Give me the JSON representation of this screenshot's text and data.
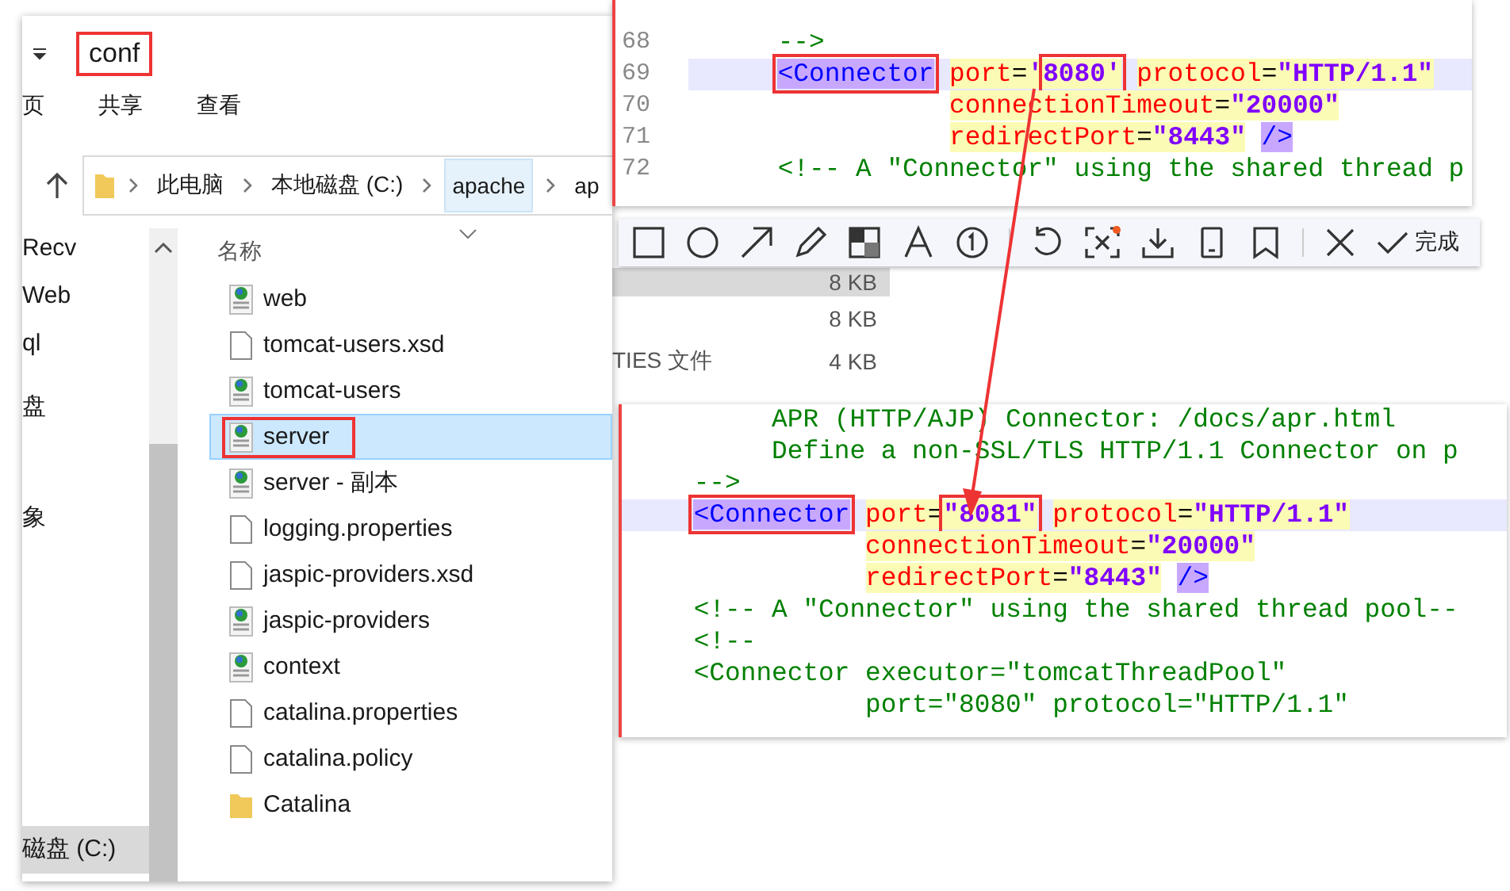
{
  "background_window": {
    "detail_rows": [
      {
        "size": "8 KB",
        "selected": true
      },
      {
        "size": "8 KB",
        "selected": false
      },
      {
        "type": "TIES 文件",
        "size": "4 KB",
        "selected": false
      }
    ]
  },
  "explorer": {
    "title": {
      "text": "conf",
      "annotated": true
    },
    "ribbon_tabs": [
      "页",
      "共享",
      "查看"
    ],
    "address": [
      {
        "label": "此电脑",
        "selected": false
      },
      {
        "label": "本地磁盘 (C:)",
        "selected": false
      },
      {
        "label": "apache",
        "selected": true
      },
      {
        "label": "ap",
        "selected": false
      }
    ],
    "sidebar": [
      {
        "label": "Recv",
        "selected": false
      },
      {
        "label": "Web",
        "selected": false
      },
      {
        "label": "ql",
        "selected": false
      },
      {
        "label": "盘",
        "selected": false
      },
      {
        "label": "象",
        "selected": false
      },
      {
        "label": "磁盘 (C:)",
        "selected": true
      }
    ],
    "column_header": "名称",
    "files": [
      {
        "name": "web",
        "kind": "xml",
        "selected": false,
        "annotated": false
      },
      {
        "name": "tomcat-users.xsd",
        "kind": "file",
        "selected": false,
        "annotated": false
      },
      {
        "name": "tomcat-users",
        "kind": "xml",
        "selected": false,
        "annotated": false
      },
      {
        "name": "server",
        "kind": "xml",
        "selected": true,
        "annotated": true
      },
      {
        "name": "server - 副本",
        "kind": "xml",
        "selected": false,
        "annotated": false
      },
      {
        "name": "logging.properties",
        "kind": "file",
        "selected": false,
        "annotated": false
      },
      {
        "name": "jaspic-providers.xsd",
        "kind": "file",
        "selected": false,
        "annotated": false
      },
      {
        "name": "jaspic-providers",
        "kind": "xml",
        "selected": false,
        "annotated": false
      },
      {
        "name": "context",
        "kind": "xml",
        "selected": false,
        "annotated": false
      },
      {
        "name": "catalina.properties",
        "kind": "file",
        "selected": false,
        "annotated": false
      },
      {
        "name": "catalina.policy",
        "kind": "file",
        "selected": false,
        "annotated": false
      },
      {
        "name": "Catalina",
        "kind": "folder",
        "selected": false,
        "annotated": false
      }
    ]
  },
  "code_before": {
    "lines": [
      {
        "number": "68",
        "kind": "element",
        "current": false,
        "tokens": [
          {
            "text": "-->",
            "kind": "comment",
            "boxed": false
          }
        ]
      },
      {
        "number": "69",
        "kind": "element",
        "current": true,
        "tokens": [
          {
            "text": "<Connector",
            "kind": "tag",
            "boxed": true
          },
          {
            "text": "port",
            "kind": "attr",
            "boxed": false
          },
          {
            "text": "=",
            "kind": "eq",
            "boxed": false
          },
          {
            "text": "'",
            "kind": "str",
            "boxed": false
          },
          {
            "text": "8080'",
            "kind": "str",
            "boxed": true
          },
          {
            "text": "protocol",
            "kind": "attr",
            "boxed": false
          },
          {
            "text": "=",
            "kind": "eq",
            "boxed": false
          },
          {
            "text": "\"HTTP/1.1\"",
            "kind": "str",
            "boxed": false
          }
        ]
      },
      {
        "number": "70",
        "kind": "continuation",
        "current": false,
        "tokens": [
          {
            "text": "connectionTimeout",
            "kind": "attr",
            "boxed": false
          },
          {
            "text": "=",
            "kind": "eq",
            "boxed": false
          },
          {
            "text": "\"20000\"",
            "kind": "str",
            "boxed": false
          }
        ]
      },
      {
        "number": "71",
        "kind": "continuation",
        "current": false,
        "tokens": [
          {
            "text": "redirectPort",
            "kind": "attr",
            "boxed": false
          },
          {
            "text": "=",
            "kind": "eq",
            "boxed": false
          },
          {
            "text": "\"8443\"",
            "kind": "str",
            "boxed": false
          },
          {
            "text": "/>",
            "kind": "tag",
            "boxed": false
          }
        ]
      },
      {
        "number": "72",
        "kind": "element",
        "current": false,
        "tokens": [
          {
            "text": "<!-- A \"Connector\" using the shared thread p",
            "kind": "comment",
            "boxed": false
          }
        ]
      }
    ]
  },
  "capture_toolbar": {
    "done_label": "完成"
  },
  "code_after": {
    "lines": [
      {
        "kind": "comment-body",
        "current": false,
        "tokens": [
          {
            "text": "APR (HTTP/AJP) Connector: /docs/apr.html",
            "kind": "comment",
            "boxed": false
          }
        ]
      },
      {
        "kind": "comment-body",
        "current": false,
        "tokens": [
          {
            "text": "Define a non-SSL/TLS HTTP/1.1 Connector on p",
            "kind": "comment",
            "boxed": false
          }
        ]
      },
      {
        "kind": "element",
        "current": false,
        "tokens": [
          {
            "text": "-->",
            "kind": "comment",
            "boxed": false
          }
        ]
      },
      {
        "kind": "element",
        "current": true,
        "tokens": [
          {
            "text": "<Connector",
            "kind": "tag",
            "boxed": true
          },
          {
            "text": "port",
            "kind": "attr",
            "boxed": false
          },
          {
            "text": "=",
            "kind": "eq",
            "boxed": false
          },
          {
            "text": "\"8081\"",
            "kind": "str",
            "boxed": true
          },
          {
            "text": "protocol",
            "kind": "attr",
            "boxed": false
          },
          {
            "text": "=",
            "kind": "eq",
            "boxed": false
          },
          {
            "text": "\"HTTP/1.1\"",
            "kind": "str",
            "boxed": false
          }
        ]
      },
      {
        "kind": "continuation",
        "current": false,
        "tokens": [
          {
            "text": "connectionTimeout",
            "kind": "attr",
            "boxed": false
          },
          {
            "text": "=",
            "kind": "eq",
            "boxed": false
          },
          {
            "text": "\"20000\"",
            "kind": "str",
            "boxed": false
          }
        ]
      },
      {
        "kind": "continuation",
        "current": false,
        "tokens": [
          {
            "text": "redirectPort",
            "kind": "attr",
            "boxed": false
          },
          {
            "text": "=",
            "kind": "eq",
            "boxed": false
          },
          {
            "text": "\"8443\"",
            "kind": "str",
            "boxed": false
          },
          {
            "text": "/>",
            "kind": "tag",
            "boxed": false
          }
        ]
      },
      {
        "kind": "element",
        "current": false,
        "tokens": [
          {
            "text": "<!-- A \"Connector\" using the shared thread pool--",
            "kind": "comment",
            "boxed": false
          }
        ]
      },
      {
        "kind": "element",
        "current": false,
        "tokens": [
          {
            "text": "<!--",
            "kind": "comment",
            "boxed": false
          }
        ]
      },
      {
        "kind": "element",
        "current": false,
        "tokens": [
          {
            "text": "<Connector executor=\"tomcatThreadPool\"",
            "kind": "comment",
            "boxed": false
          }
        ]
      },
      {
        "kind": "continuation",
        "current": false,
        "tokens": [
          {
            "text": "port=\"8080\" protocol=\"HTTP/1.1\"",
            "kind": "comment",
            "boxed": false
          }
        ]
      }
    ]
  }
}
